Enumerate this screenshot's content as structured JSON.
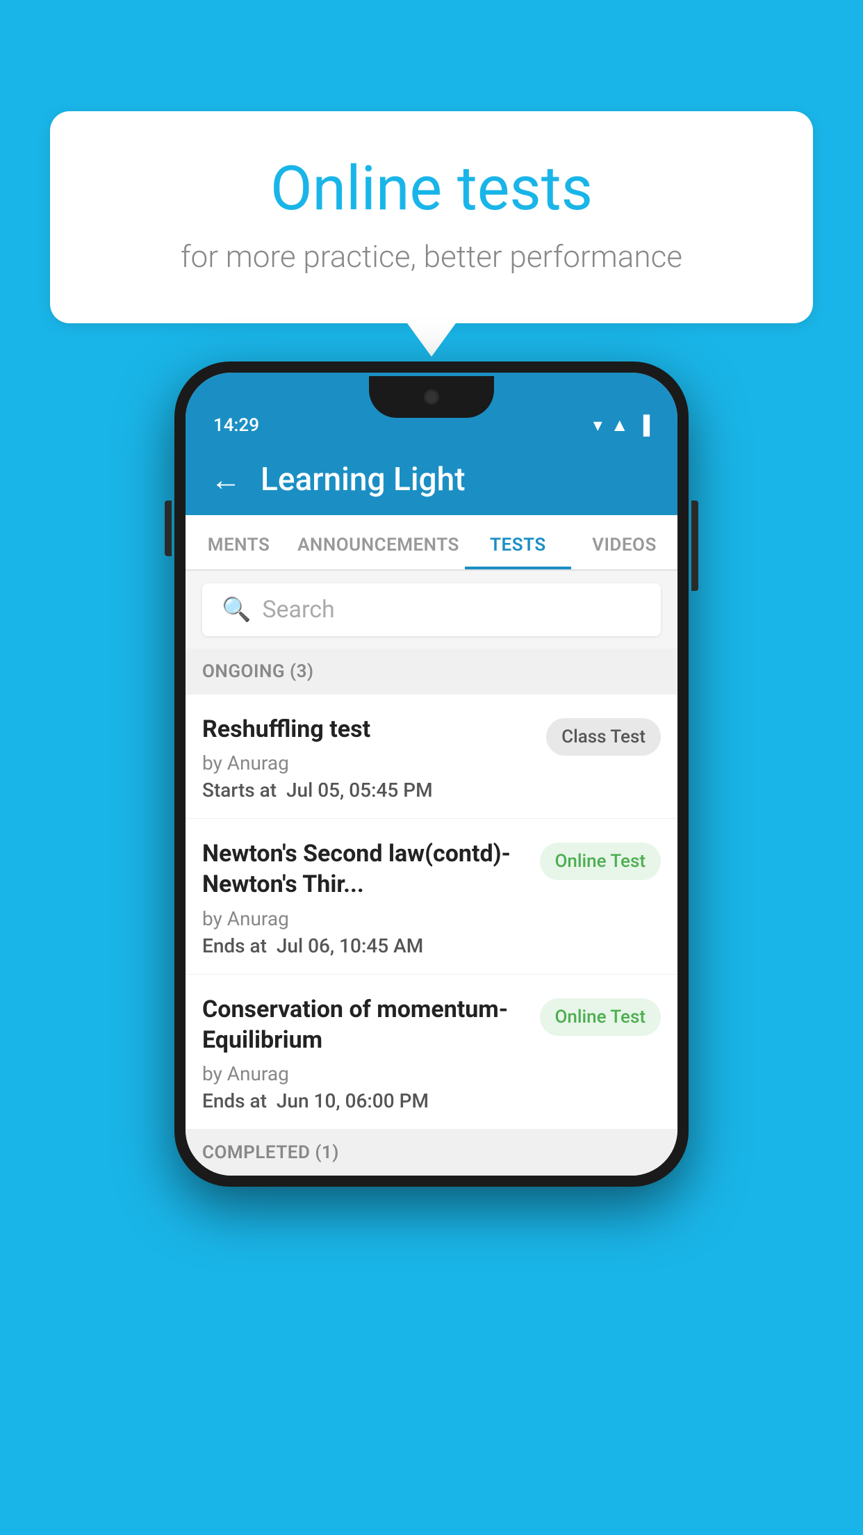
{
  "background_color": "#1ab5e8",
  "speech_bubble": {
    "title": "Online tests",
    "subtitle": "for more practice, better performance"
  },
  "phone": {
    "status_bar": {
      "time": "14:29",
      "icons": [
        "wifi",
        "signal",
        "battery"
      ]
    },
    "header": {
      "back_label": "←",
      "title": "Learning Light"
    },
    "tabs": [
      {
        "label": "MENTS",
        "active": false
      },
      {
        "label": "ANNOUNCEMENTS",
        "active": false
      },
      {
        "label": "TESTS",
        "active": true
      },
      {
        "label": "VIDEOS",
        "active": false
      }
    ],
    "search": {
      "placeholder": "Search"
    },
    "ongoing_section": {
      "label": "ONGOING (3)"
    },
    "tests": [
      {
        "name": "Reshuffling test",
        "by": "by Anurag",
        "date_label": "Starts at",
        "date": "Jul 05, 05:45 PM",
        "badge": "Class Test",
        "badge_type": "class"
      },
      {
        "name": "Newton's Second law(contd)-Newton's Thir...",
        "by": "by Anurag",
        "date_label": "Ends at",
        "date": "Jul 06, 10:45 AM",
        "badge": "Online Test",
        "badge_type": "online"
      },
      {
        "name": "Conservation of momentum-Equilibrium",
        "by": "by Anurag",
        "date_label": "Ends at",
        "date": "Jun 10, 06:00 PM",
        "badge": "Online Test",
        "badge_type": "online"
      }
    ],
    "completed_section": {
      "label": "COMPLETED (1)"
    }
  }
}
